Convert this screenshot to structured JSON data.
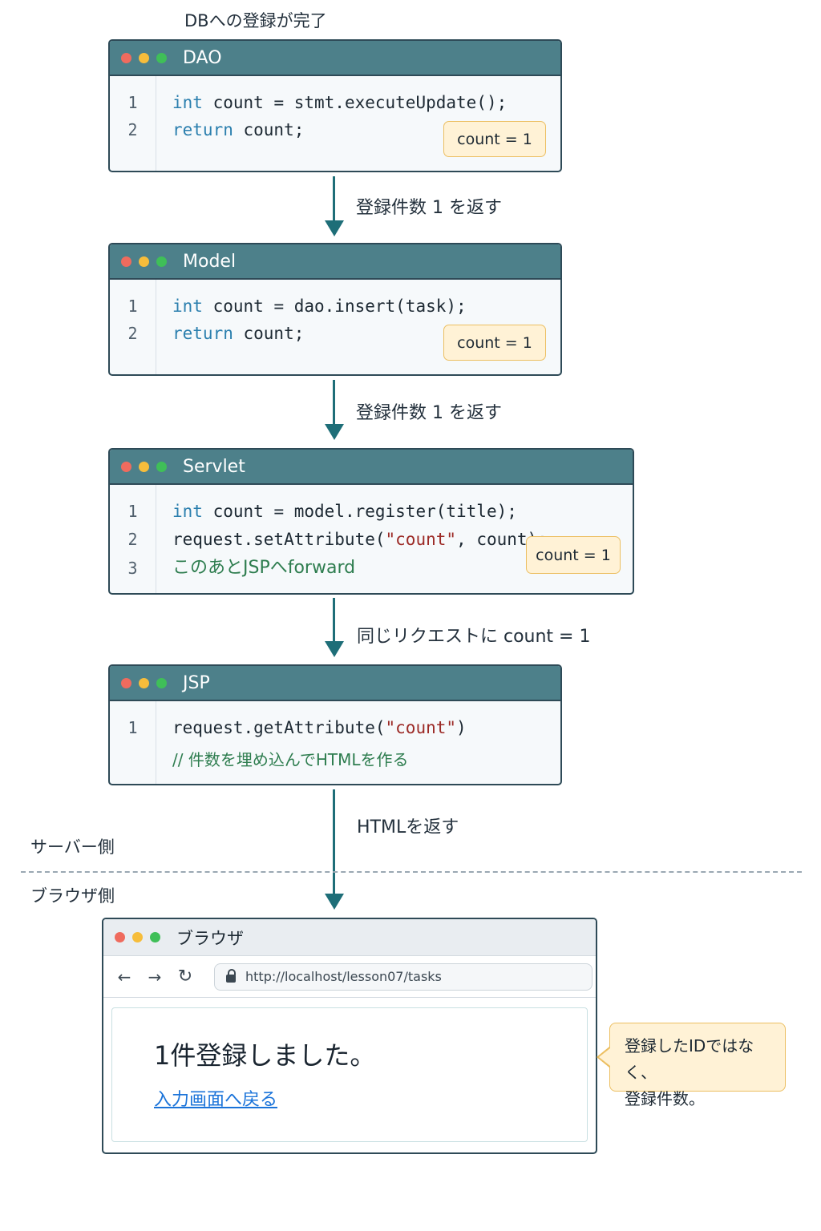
{
  "top_caption": "DBへの登録が完了",
  "colors": {
    "dot_red": "#ef6b5e",
    "dot_yellow": "#f6bd3b",
    "dot_green": "#3fbf58",
    "titlebar": "#4d808a",
    "arrow": "#1e6e78",
    "badge_bg": "#fff2d6"
  },
  "windows": {
    "dao": {
      "title": "DAO",
      "line_numbers": [
        "1",
        "2"
      ],
      "lines": [
        {
          "kw": "int",
          "rest": " count = stmt.executeUpdate();"
        },
        {
          "kw": "return",
          "rest": " count;"
        }
      ],
      "badge": "count = 1"
    },
    "model": {
      "title": "Model",
      "line_numbers": [
        "1",
        "2"
      ],
      "lines": [
        {
          "kw": "int",
          "rest": " count = dao.insert(task);"
        },
        {
          "kw": "return",
          "rest": " count;"
        }
      ],
      "badge": "count = 1"
    },
    "servlet": {
      "title": "Servlet",
      "line_numbers": [
        "1",
        "2",
        "3"
      ],
      "line1": {
        "kw": "int",
        "rest": " count = model.register(title);"
      },
      "line2": {
        "pre": "request.setAttribute(",
        "str": "\"count\"",
        "post": ", count);"
      },
      "line3": "このあとJSPへforward",
      "badge": "count = 1"
    },
    "jsp": {
      "title": "JSP",
      "line_numbers": [
        "1"
      ],
      "line1": {
        "pre": "request.getAttribute(",
        "str": "\"count\"",
        "post": ")"
      },
      "comment": "// 件数を埋め込んでHTMLを作る"
    }
  },
  "arrows": {
    "a1": "登録件数 1 を返す",
    "a2": "登録件数 1 を返す",
    "a3": "同じリクエストに count = 1",
    "a4": "HTMLを返す"
  },
  "sides": {
    "server": "サーバー側",
    "browser": "ブラウザ側"
  },
  "browser": {
    "title": "ブラウザ",
    "nav_back": "←",
    "nav_forward": "→",
    "nav_reload": "↻",
    "url": "http://localhost/lesson07/tasks",
    "message": "1件登録しました。",
    "link": "入力画面へ戻る"
  },
  "callout": {
    "line1": "登録したIDではなく、",
    "line2": "登録件数。"
  }
}
